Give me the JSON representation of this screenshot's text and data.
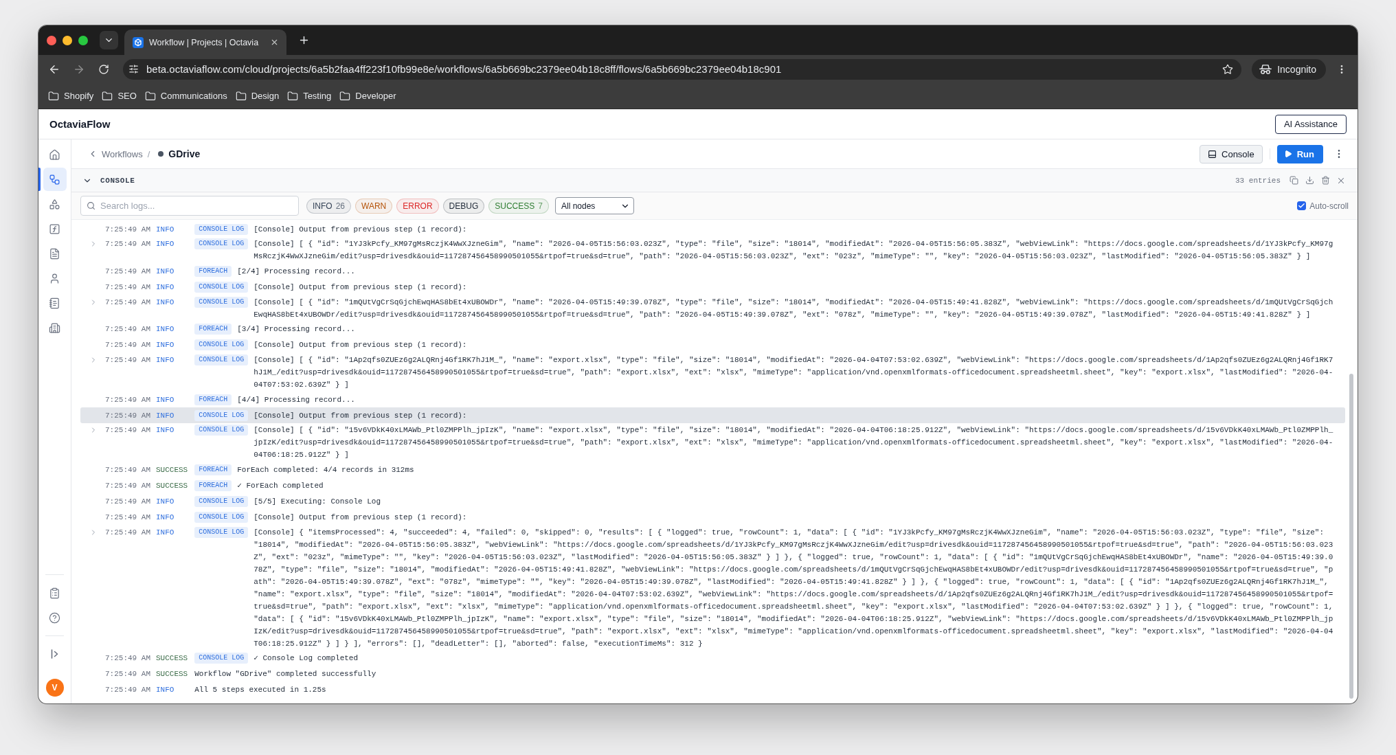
{
  "browser": {
    "tab": {
      "title": "Workflow | Projects | Octavia"
    },
    "url": "beta.octaviaflow.com/cloud/projects/6a5b2faa4ff223f10fb99e8e/workflows/6a5b669bc2379ee04b18c8ff/flows/6a5b669bc2379ee04b18c901",
    "profile": "Incognito",
    "bookmarks": [
      "Shopify",
      "SEO",
      "Communications",
      "Design",
      "Testing",
      "Developer"
    ]
  },
  "app": {
    "name": "OctaviaFlow",
    "assistant_button": "AI Assistance"
  },
  "sidebar": {
    "items": [
      {
        "selected": false
      },
      {
        "selected": true
      },
      {
        "selected": false
      },
      {
        "selected": false
      },
      {
        "selected": false
      },
      {
        "selected": false
      },
      {
        "selected": false
      },
      {
        "selected": false
      }
    ],
    "avatar": "V"
  },
  "breadcrumb": {
    "parent": "Workflows",
    "separator": "/",
    "current": "GDrive"
  },
  "actions": {
    "console_button": "Console",
    "run_button": "Run"
  },
  "console": {
    "title": "CONSOLE",
    "expanded": true,
    "entries": "33 entries",
    "search": {
      "placeholder": "Search logs..."
    },
    "filters": [
      {
        "label": "INFO",
        "count": "26",
        "color": "#334155"
      },
      {
        "label": "WARN",
        "color": "#b45309"
      },
      {
        "label": "ERROR",
        "color": "#dc2626"
      },
      {
        "label": "DEBUG",
        "color": "#1f2937"
      },
      {
        "label": "SUCCESS",
        "count": "7",
        "color": "#2e7d32"
      }
    ],
    "node_filter": "All nodes",
    "auto_scroll": {
      "label": "Auto-scroll",
      "checked": true
    },
    "rows": [
      {
        "time": "7:25:49 AM",
        "level": "INFO",
        "color": "#2f6fde",
        "tag": "CONSOLE LOG",
        "message": "[Console] Output from previous step (1 record):",
        "expandable": false,
        "highlighted": false
      },
      {
        "time": "7:25:49 AM",
        "level": "INFO",
        "color": "#2f6fde",
        "tag": "CONSOLE LOG",
        "message": "[Console] [ { \"id\": \"1YJ3kPcfy_KM97gMsRczjK4WwXJzneGim\", \"name\": \"2026-04-05T15:56:03.023Z\", \"type\": \"file\", \"size\": \"18014\", \"modifiedAt\": \"2026-04-05T15:56:05.383Z\", \"webViewLink\": \"https://docs.google.com/spreadsheets/d/1YJ3kPcfy_KM97gMsRczjK4WwXJzneGim/edit?usp=drivesdk&ouid=117287456458990501055&rtpof=true&sd=true\", \"path\": \"2026-04-05T15:56:03.023Z\", \"ext\": \"023z\", \"mimeType\": \"\", \"key\": \"2026-04-05T15:56:03.023Z\", \"lastModified\": \"2026-04-05T15:56:05.383Z\" } ]",
        "expandable": true,
        "highlighted": false
      },
      {
        "time": "7:25:49 AM",
        "level": "INFO",
        "color": "#2f6fde",
        "tag": "FOREACH",
        "message": "[2/4] Processing record...",
        "expandable": false,
        "highlighted": false
      },
      {
        "time": "7:25:49 AM",
        "level": "INFO",
        "color": "#2f6fde",
        "tag": "CONSOLE LOG",
        "message": "[Console] Output from previous step (1 record):",
        "expandable": false,
        "highlighted": false
      },
      {
        "time": "7:25:49 AM",
        "level": "INFO",
        "color": "#2f6fde",
        "tag": "CONSOLE LOG",
        "message": "[Console] [ { \"id\": \"1mQUtVgCrSqGjchEwqHAS8bEt4xUBOWDr\", \"name\": \"2026-04-05T15:49:39.078Z\", \"type\": \"file\", \"size\": \"18014\", \"modifiedAt\": \"2026-04-05T15:49:41.828Z\", \"webViewLink\": \"https://docs.google.com/spreadsheets/d/1mQUtVgCrSqGjchEwqHAS8bEt4xUBOWDr/edit?usp=drivesdk&ouid=117287456458990501055&rtpof=true&sd=true\", \"path\": \"2026-04-05T15:49:39.078Z\", \"ext\": \"078z\", \"mimeType\": \"\", \"key\": \"2026-04-05T15:49:39.078Z\", \"lastModified\": \"2026-04-05T15:49:41.828Z\" } ]",
        "expandable": true,
        "highlighted": false
      },
      {
        "time": "7:25:49 AM",
        "level": "INFO",
        "color": "#2f6fde",
        "tag": "FOREACH",
        "message": "[3/4] Processing record...",
        "expandable": false,
        "highlighted": false
      },
      {
        "time": "7:25:49 AM",
        "level": "INFO",
        "color": "#2f6fde",
        "tag": "CONSOLE LOG",
        "message": "[Console] Output from previous step (1 record):",
        "expandable": false,
        "highlighted": false
      },
      {
        "time": "7:25:49 AM",
        "level": "INFO",
        "color": "#2f6fde",
        "tag": "CONSOLE LOG",
        "message": "[Console] [ { \"id\": \"1Ap2qfs0ZUEz6g2ALQRnj4Gf1RK7hJ1M_\", \"name\": \"export.xlsx\", \"type\": \"file\", \"size\": \"18014\", \"modifiedAt\": \"2026-04-04T07:53:02.639Z\", \"webViewLink\": \"https://docs.google.com/spreadsheets/d/1Ap2qfs0ZUEz6g2ALQRnj4Gf1RK7hJ1M_/edit?usp=drivesdk&ouid=117287456458990501055&rtpof=true&sd=true\", \"path\": \"export.xlsx\", \"ext\": \"xlsx\", \"mimeType\": \"application/vnd.openxmlformats-officedocument.spreadsheetml.sheet\", \"key\": \"export.xlsx\", \"lastModified\": \"2026-04-04T07:53:02.639Z\" } ]",
        "expandable": true,
        "highlighted": false
      },
      {
        "time": "7:25:49 AM",
        "level": "INFO",
        "color": "#2f6fde",
        "tag": "FOREACH",
        "message": "[4/4] Processing record...",
        "expandable": false,
        "highlighted": false
      },
      {
        "time": "7:25:49 AM",
        "level": "INFO",
        "color": "#2f6fde",
        "tag": "CONSOLE LOG",
        "message": "[Console] Output from previous step (1 record):",
        "expandable": false,
        "highlighted": true
      },
      {
        "time": "7:25:49 AM",
        "level": "INFO",
        "color": "#2f6fde",
        "tag": "CONSOLE LOG",
        "message": "[Console] [ { \"id\": \"15v6VDkK40xLMAWb_Ptl0ZMPPlh_jpIzK\", \"name\": \"export.xlsx\", \"type\": \"file\", \"size\": \"18014\", \"modifiedAt\": \"2026-04-04T06:18:25.912Z\", \"webViewLink\": \"https://docs.google.com/spreadsheets/d/15v6VDkK40xLMAWb_Ptl0ZMPPlh_jpIzK/edit?usp=drivesdk&ouid=117287456458990501055&rtpof=true&sd=true\", \"path\": \"export.xlsx\", \"ext\": \"xlsx\", \"mimeType\": \"application/vnd.openxmlformats-officedocument.spreadsheetml.sheet\", \"key\": \"export.xlsx\", \"lastModified\": \"2026-04-04T06:18:25.912Z\" } ]",
        "expandable": true,
        "highlighted": false
      },
      {
        "time": "7:25:49 AM",
        "level": "SUCCESS",
        "color": "#3a6b47",
        "tag": "FOREACH",
        "message": "ForEach completed: 4/4 records in 312ms",
        "expandable": false,
        "highlighted": false
      },
      {
        "time": "7:25:49 AM",
        "level": "SUCCESS",
        "color": "#3a6b47",
        "tag": "FOREACH",
        "message": "✓ ForEach completed",
        "expandable": false,
        "highlighted": false
      },
      {
        "time": "7:25:49 AM",
        "level": "INFO",
        "color": "#2f6fde",
        "tag": "CONSOLE LOG",
        "message": "[5/5] Executing: Console Log",
        "expandable": false,
        "highlighted": false
      },
      {
        "time": "7:25:49 AM",
        "level": "INFO",
        "color": "#2f6fde",
        "tag": "CONSOLE LOG",
        "message": "[Console] Output from previous step (1 record):",
        "expandable": false,
        "highlighted": false
      },
      {
        "time": "7:25:49 AM",
        "level": "INFO",
        "color": "#2f6fde",
        "tag": "CONSOLE LOG",
        "message": "[Console] { \"itemsProcessed\": 4, \"succeeded\": 4, \"failed\": 0, \"skipped\": 0, \"results\": [ { \"logged\": true, \"rowCount\": 1, \"data\": [ { \"id\": \"1YJ3kPcfy_KM97gMsRczjK4WwXJzneGim\", \"name\": \"2026-04-05T15:56:03.023Z\", \"type\": \"file\", \"size\": \"18014\", \"modifiedAt\": \"2026-04-05T15:56:05.383Z\", \"webViewLink\": \"https://docs.google.com/spreadsheets/d/1YJ3kPcfy_KM97gMsRczjK4WwXJzneGim/edit?usp=drivesdk&ouid=117287456458990501055&rtpof=true&sd=true\", \"path\": \"2026-04-05T15:56:03.023Z\", \"ext\": \"023z\", \"mimeType\": \"\", \"key\": \"2026-04-05T15:56:03.023Z\", \"lastModified\": \"2026-04-05T15:56:05.383Z\" } ] }, { \"logged\": true, \"rowCount\": 1, \"data\": [ { \"id\": \"1mQUtVgCrSqGjchEwqHAS8bEt4xUBOWDr\", \"name\": \"2026-04-05T15:49:39.078Z\", \"type\": \"file\", \"size\": \"18014\", \"modifiedAt\": \"2026-04-05T15:49:41.828Z\", \"webViewLink\": \"https://docs.google.com/spreadsheets/d/1mQUtVgCrSqGjchEwqHAS8bEt4xUBOWDr/edit?usp=drivesdk&ouid=117287456458990501055&rtpof=true&sd=true\", \"path\": \"2026-04-05T15:49:39.078Z\", \"ext\": \"078z\", \"mimeType\": \"\", \"key\": \"2026-04-05T15:49:39.078Z\", \"lastModified\": \"2026-04-05T15:49:41.828Z\" } ] }, { \"logged\": true, \"rowCount\": 1, \"data\": [ { \"id\": \"1Ap2qfs0ZUEz6g2ALQRnj4Gf1RK7hJ1M_\", \"name\": \"export.xlsx\", \"type\": \"file\", \"size\": \"18014\", \"modifiedAt\": \"2026-04-04T07:53:02.639Z\", \"webViewLink\": \"https://docs.google.com/spreadsheets/d/1Ap2qfs0ZUEz6g2ALQRnj4Gf1RK7hJ1M_/edit?usp=drivesdk&ouid=117287456458990501055&rtpof=true&sd=true\", \"path\": \"export.xlsx\", \"ext\": \"xlsx\", \"mimeType\": \"application/vnd.openxmlformats-officedocument.spreadsheetml.sheet\", \"key\": \"export.xlsx\", \"lastModified\": \"2026-04-04T07:53:02.639Z\" } ] }, { \"logged\": true, \"rowCount\": 1, \"data\": [ { \"id\": \"15v6VDkK40xLMAWb_Ptl0ZMPPlh_jpIzK\", \"name\": \"export.xlsx\", \"type\": \"file\", \"size\": \"18014\", \"modifiedAt\": \"2026-04-04T06:18:25.912Z\", \"webViewLink\": \"https://docs.google.com/spreadsheets/d/15v6VDkK40xLMAWb_Ptl0ZMPPlh_jpIzK/edit?usp=drivesdk&ouid=117287456458990501055&rtpof=true&sd=true\", \"path\": \"export.xlsx\", \"ext\": \"xlsx\", \"mimeType\": \"application/vnd.openxmlformats-officedocument.spreadsheetml.sheet\", \"key\": \"export.xlsx\", \"lastModified\": \"2026-04-04T06:18:25.912Z\" } ] } ], \"errors\": [], \"deadLetter\": [], \"aborted\": false, \"executionTimeMs\": 312 }",
        "expandable": true,
        "highlighted": false
      },
      {
        "time": "7:25:49 AM",
        "level": "SUCCESS",
        "color": "#3a6b47",
        "tag": "CONSOLE LOG",
        "message": "✓ Console Log completed",
        "expandable": false,
        "highlighted": false
      },
      {
        "time": "7:25:49 AM",
        "level": "SUCCESS",
        "color": "#3a6b47",
        "message": "Workflow \"GDrive\" completed successfully",
        "expandable": false,
        "highlighted": false
      },
      {
        "time": "7:25:49 AM",
        "level": "INFO",
        "color": "#2f6fde",
        "message": "All 5 steps executed in 1.25s",
        "expandable": false,
        "highlighted": false
      }
    ]
  }
}
